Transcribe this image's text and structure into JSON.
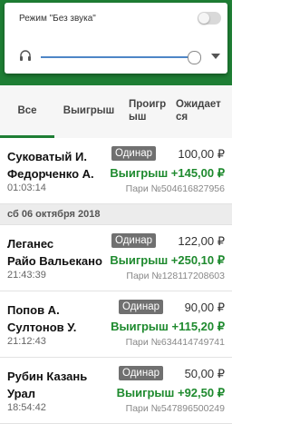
{
  "sound_panel": {
    "title": "Режим \"Без звука\"",
    "toggle_on": false,
    "volume_level": 0.95
  },
  "tabs": [
    {
      "label": "Все",
      "active": true
    },
    {
      "label": "Выигрыш",
      "active": false
    },
    {
      "label": "Проигрыш",
      "active": false
    },
    {
      "label": "Ожидается",
      "active": false
    }
  ],
  "date_separator": "сб 06 октября 2018",
  "bets": [
    {
      "team1": "Суковатый И.",
      "team2": "Федорченко А.",
      "time": "01:03:14",
      "type": "Одинар",
      "amount": "100,00 ₽",
      "result": "Выигрыш +145,00 ₽",
      "bet_no": "Пари №504616827956"
    },
    {
      "team1": "Леганес",
      "team2": "Райо Вальекано",
      "time": "21:43:39",
      "type": "Одинар",
      "amount": "122,00 ₽",
      "result": "Выигрыш +250,10 ₽",
      "bet_no": "Пари №128117208603"
    },
    {
      "team1": "Попов А.",
      "team2": "Султонов У.",
      "time": "21:12:43",
      "type": "Одинар",
      "amount": "90,00 ₽",
      "result": "Выигрыш +115,20 ₽",
      "bet_no": "Пари №634414749741"
    },
    {
      "team1": "Рубин Казань",
      "team2": "Урал",
      "time": "18:54:42",
      "type": "Одинар",
      "amount": "50,00 ₽",
      "result": "Выигрыш +92,50 ₽",
      "bet_no": "Пари №547896500249"
    }
  ],
  "colors": {
    "brand_green": "#1e7e34",
    "win_green": "#1e8a2e",
    "slider_blue": "#4e86c6"
  },
  "icons": {
    "headphones": "headphones-icon",
    "dropdown": "chevron-down-icon"
  }
}
